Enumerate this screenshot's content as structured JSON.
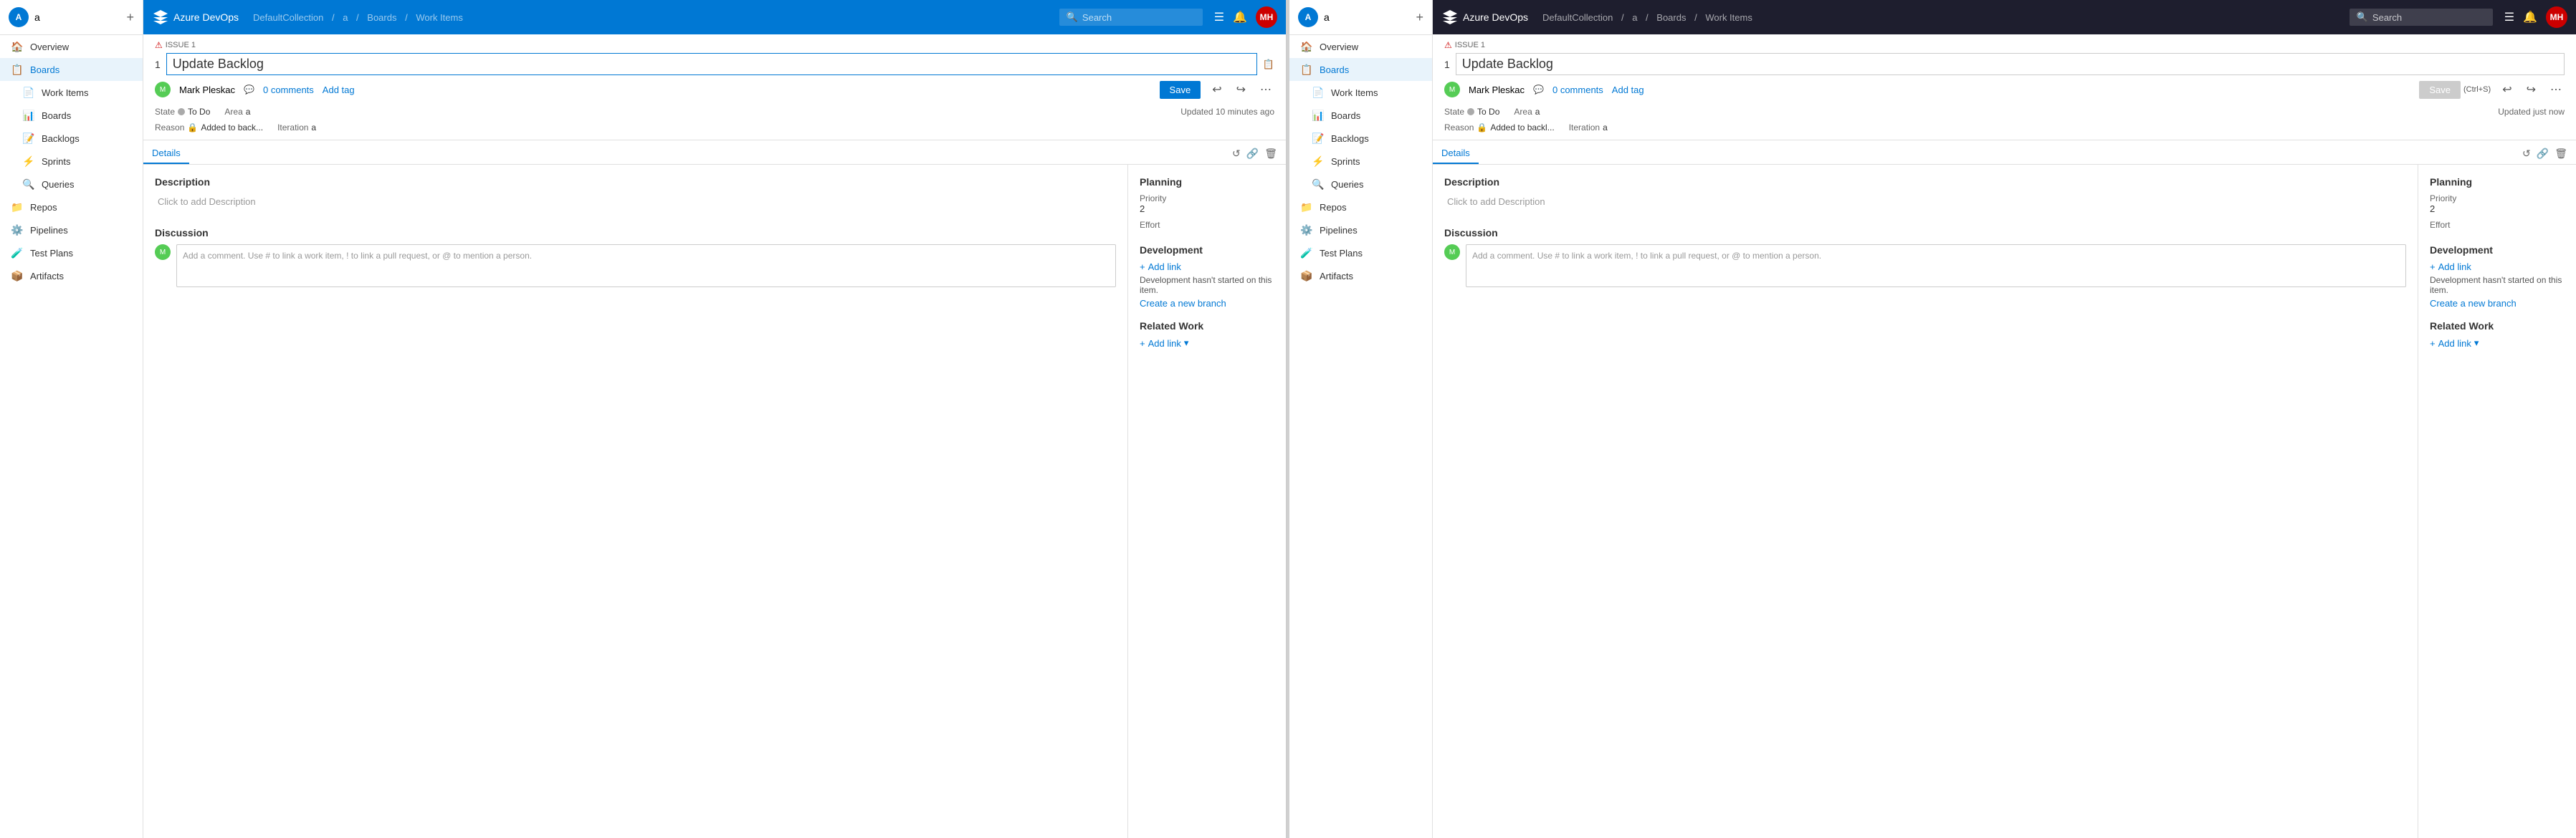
{
  "left_panel": {
    "top_nav": {
      "logo_text": "Azure DevOps",
      "breadcrumb": [
        "DefaultCollection",
        "a",
        "Boards",
        "Work Items"
      ],
      "search_placeholder": "Search",
      "icons": [
        "list-icon",
        "notification-icon"
      ],
      "avatar_initials": "MH"
    },
    "sidebar": {
      "project_name": "a",
      "avatar_initials": "A",
      "items": [
        {
          "label": "Overview",
          "icon": "🏠",
          "active": false
        },
        {
          "label": "Boards",
          "icon": "📋",
          "active": true
        },
        {
          "label": "Work Items",
          "icon": "📄",
          "active": false
        },
        {
          "label": "Boards",
          "icon": "📊",
          "active": false
        },
        {
          "label": "Backlogs",
          "icon": "📝",
          "active": false
        },
        {
          "label": "Sprints",
          "icon": "⚡",
          "active": false
        },
        {
          "label": "Queries",
          "icon": "🔍",
          "active": false
        },
        {
          "label": "Repos",
          "icon": "📁",
          "active": false
        },
        {
          "label": "Pipelines",
          "icon": "⚙️",
          "active": false
        },
        {
          "label": "Test Plans",
          "icon": "🧪",
          "active": false
        },
        {
          "label": "Artifacts",
          "icon": "📦",
          "active": false
        }
      ]
    },
    "work_item": {
      "issue_label": "ISSUE 1",
      "number": "1",
      "title": "Update Backlog",
      "author": "Mark Pleskac",
      "comments": "0 comments",
      "add_tag": "Add tag",
      "state": "To Do",
      "area": "a",
      "reason": "Added to back...",
      "iteration": "a",
      "updated": "Updated 10 minutes ago",
      "save_label": "Save",
      "details_tab": "Details",
      "description_title": "Description",
      "description_placeholder": "Click to add Description",
      "planning_title": "Planning",
      "priority_label": "Priority",
      "priority_value": "2",
      "effort_label": "Effort",
      "discussion_title": "Discussion",
      "comment_placeholder": "Add a comment. Use # to link a work item, ! to link a pull request, or @ to mention a person.",
      "development_title": "Development",
      "add_link_label": "+ Add link",
      "dev_status": "Development hasn't started on this item.",
      "create_branch": "Create a new branch",
      "related_work_title": "Related Work",
      "related_add_link": "+ Add link"
    }
  },
  "right_panel": {
    "top_nav": {
      "logo_text": "Azure DevOps",
      "breadcrumb": [
        "DefaultCollection",
        "a",
        "Boards",
        "Work Items"
      ],
      "search_placeholder": "Search",
      "icons": [
        "list-icon",
        "notification-icon"
      ],
      "avatar_initials": "MH"
    },
    "sidebar": {
      "project_name": "a",
      "avatar_initials": "A",
      "items": [
        {
          "label": "Overview",
          "icon": "🏠",
          "active": false
        },
        {
          "label": "Boards",
          "icon": "📋",
          "active": true
        },
        {
          "label": "Work Items",
          "icon": "📄",
          "active": false
        },
        {
          "label": "Boards",
          "icon": "📊",
          "active": false
        },
        {
          "label": "Backlogs",
          "icon": "📝",
          "active": false
        },
        {
          "label": "Sprints",
          "icon": "⚡",
          "active": false
        },
        {
          "label": "Queries",
          "icon": "🔍",
          "active": false
        },
        {
          "label": "Repos",
          "icon": "📁",
          "active": false
        },
        {
          "label": "Pipelines",
          "icon": "⚙️",
          "active": false
        },
        {
          "label": "Test Plans",
          "icon": "🧪",
          "active": false
        },
        {
          "label": "Artifacts",
          "icon": "📦",
          "active": false
        }
      ]
    },
    "work_item": {
      "issue_label": "ISSUE 1",
      "number": "1",
      "title": "Update Backlog",
      "author": "Mark Pleskac",
      "comments": "0 comments",
      "add_tag": "Add tag",
      "state": "To Do",
      "area": "a",
      "reason": "Added to backl...",
      "iteration": "a",
      "updated": "Updated just now",
      "save_label": "Save",
      "save_shortcut": "(Ctrl+S)",
      "details_tab": "Details",
      "description_title": "Description",
      "description_placeholder": "Click to add Description",
      "planning_title": "Planning",
      "priority_label": "Priority",
      "priority_value": "2",
      "effort_label": "Effort",
      "discussion_title": "Discussion",
      "comment_placeholder": "Add a comment. Use # to link a work item, ! to link a pull request, or @ to mention a person.",
      "development_title": "Development",
      "add_link_label": "+ Add link",
      "dev_status": "Development hasn't started on this item.",
      "create_branch": "Create a new branch",
      "related_work_title": "Related Work",
      "related_add_link": "+ Add link"
    }
  }
}
